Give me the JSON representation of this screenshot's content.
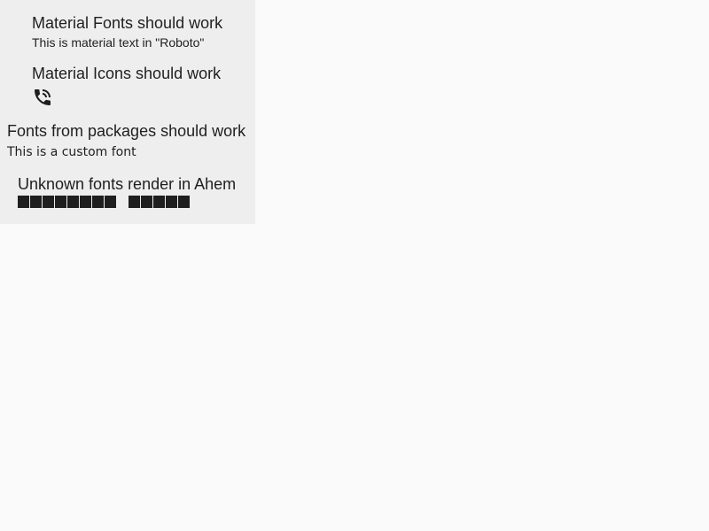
{
  "material_fonts": {
    "title": "Material Fonts should work",
    "subtitle": "This is material text in \"Roboto\""
  },
  "material_icons": {
    "title": "Material Icons should work",
    "icon": "phone-in-talk-icon"
  },
  "package_fonts": {
    "title": "Fonts from packages should work",
    "subtitle": "This is a custom font"
  },
  "unknown_fonts": {
    "title": "Unknown fonts render in Ahem",
    "ahem_words": [
      8,
      5
    ]
  },
  "colors": {
    "panel_bg": "#eeeeee",
    "page_bg": "#fafafa",
    "text": "#1f1f1f"
  }
}
